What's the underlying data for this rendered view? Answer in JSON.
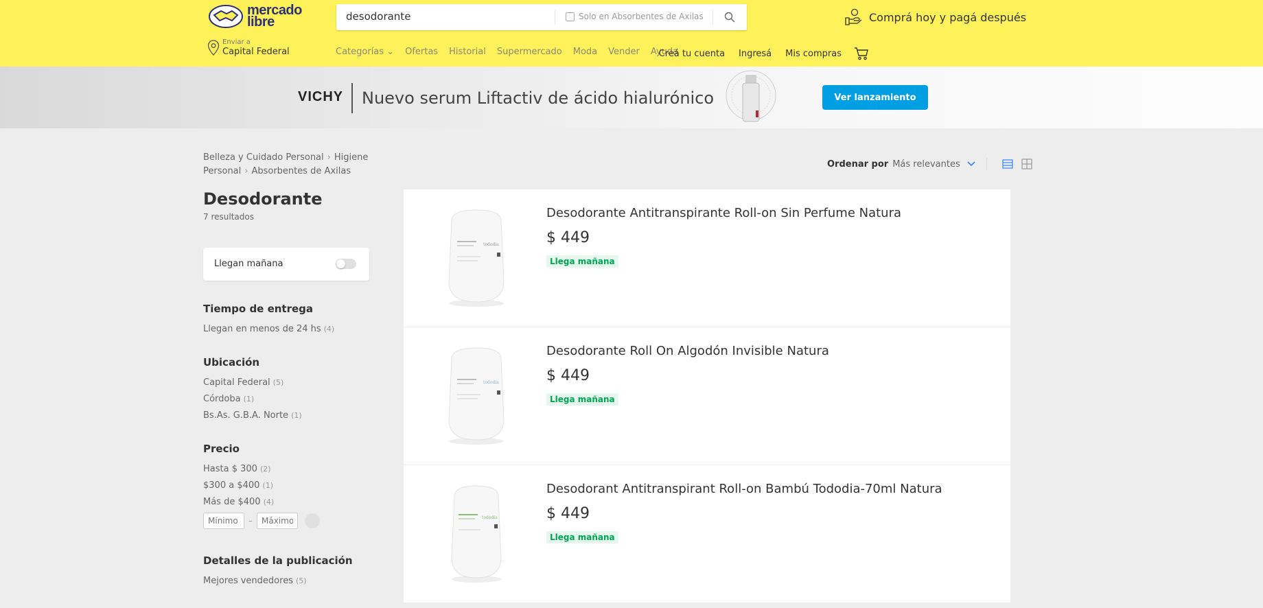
{
  "header": {
    "logo_line1": "mercado",
    "logo_line2": "libre",
    "search": {
      "value": "desodorante",
      "filter_label": "Solo en Absorbentes de Axilas"
    },
    "promo": "Comprá hoy y pagá después",
    "location": {
      "label": "Enviar a",
      "value": "Capital Federal"
    },
    "nav": [
      "Categorías",
      "Ofertas",
      "Historial",
      "Supermercado",
      "Moda",
      "Vender",
      "Ayuda"
    ],
    "account": [
      "Creá tu cuenta",
      "Ingresá",
      "Mis compras"
    ]
  },
  "banner": {
    "brand": "VICHY",
    "text": "Nuevo serum Liftactiv de ácido hialurónico",
    "cta": "Ver lanzamiento"
  },
  "breadcrumb": [
    "Belleza y Cuidado Personal",
    "Higiene Personal",
    "Absorbentes de Axilas"
  ],
  "page": {
    "title": "Desodorante",
    "results": "7 resultados"
  },
  "filters": {
    "tomorrow_label": "Llegan mañana",
    "delivery": {
      "title": "Tiempo de entrega",
      "items": [
        {
          "label": "Llegan en menos de 24 hs",
          "count": "(4)"
        }
      ]
    },
    "location": {
      "title": "Ubicación",
      "items": [
        {
          "label": "Capital Federal",
          "count": "(5)"
        },
        {
          "label": "Córdoba",
          "count": "(1)"
        },
        {
          "label": "Bs.As. G.B.A. Norte",
          "count": "(1)"
        }
      ]
    },
    "price": {
      "title": "Precio",
      "items": [
        {
          "label": "Hasta $ 300",
          "count": "(2)"
        },
        {
          "label": "$300 a $400",
          "count": "(1)"
        },
        {
          "label": "Más de $400",
          "count": "(4)"
        }
      ],
      "min_placeholder": "Mínimo",
      "max_placeholder": "Máximo"
    },
    "details": {
      "title": "Detalles de la publicación",
      "items": [
        {
          "label": "Mejores vendedores",
          "count": "(5)"
        }
      ]
    }
  },
  "sort": {
    "label": "Ordenar por",
    "value": "Más relevantes"
  },
  "products": [
    {
      "title": "Desodorante Antitranspirante Roll-on Sin Perfume Natura",
      "price": "$ 449",
      "badge": "Llega mañana"
    },
    {
      "title": "Desodorante Roll On Algodón Invisible Natura",
      "price": "$ 449",
      "badge": "Llega mañana"
    },
    {
      "title": "Desodorant Antitranspirant Roll-on Bambú Tododia-70ml Natura",
      "price": "$ 449",
      "badge": "Llega mañana"
    }
  ],
  "colors": {
    "header_bg": "#fff159",
    "brand_blue": "#2d3277",
    "cta_blue": "#009ee3",
    "delivery_green": "#00a650"
  }
}
